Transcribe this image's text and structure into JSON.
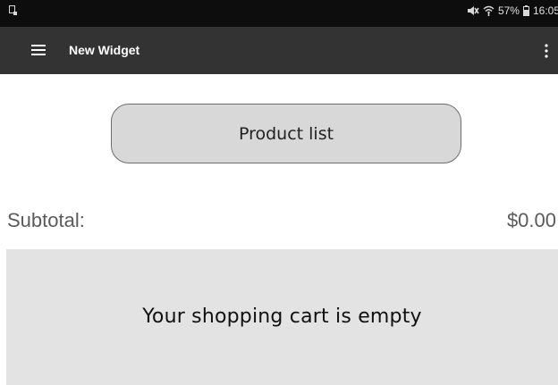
{
  "status_bar": {
    "battery_percent": "57%",
    "time": "16:05",
    "icons": [
      "screenshot-icon",
      "mute-icon",
      "wifi-icon",
      "battery-icon"
    ]
  },
  "app_bar": {
    "title": "New Widget",
    "icons": [
      "menu-icon",
      "overflow-menu-icon"
    ]
  },
  "main": {
    "product_list_label": "Product list",
    "subtotal_label": "Subtotal:",
    "subtotal_value": "$0.00",
    "cart_empty_message": "Your shopping cart is empty"
  },
  "colors": {
    "status_bar_bg": "#0d0d0d",
    "app_bar_bg": "#333333",
    "button_bg": "#d8d8d8",
    "cart_panel_bg": "#e3e3e3",
    "subtotal_text": "#5a5a5a"
  }
}
